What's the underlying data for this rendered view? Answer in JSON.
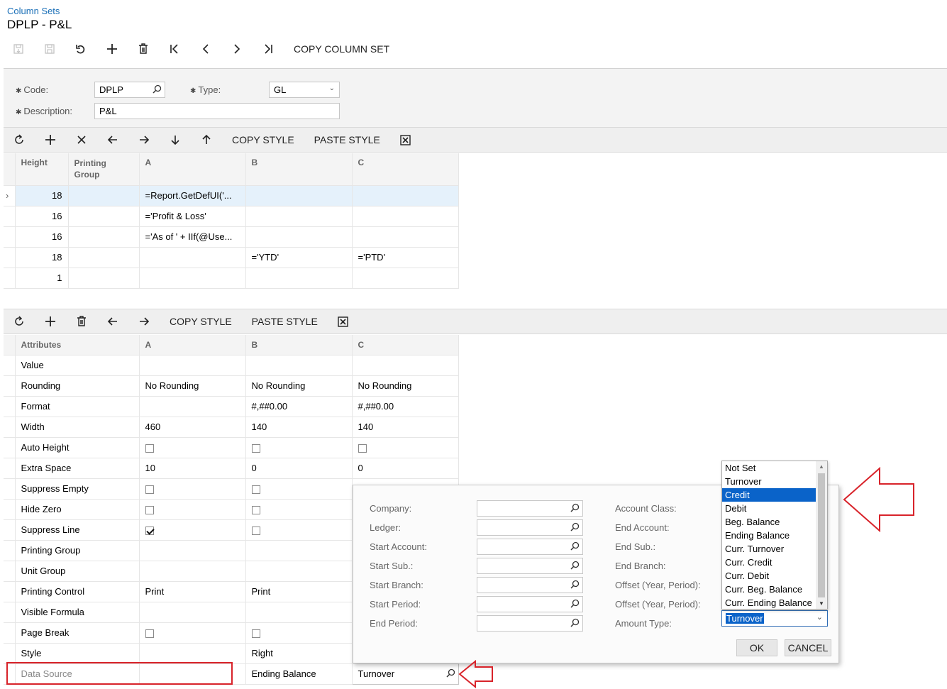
{
  "header": {
    "breadcrumb": "Column Sets",
    "title": "DPLP - P&L"
  },
  "main_toolbar": {
    "copy_column_set": "COPY COLUMN SET"
  },
  "form": {
    "code_label": "Code:",
    "code_value": "DPLP",
    "type_label": "Type:",
    "type_value": "GL",
    "description_label": "Description:",
    "description_value": "P&L"
  },
  "headers_toolbar": {
    "copy_style": "COPY STYLE",
    "paste_style": "PASTE STYLE"
  },
  "headers_grid": {
    "columns": [
      "Height",
      "Printing Group",
      "A",
      "B",
      "C"
    ],
    "rows": [
      {
        "height": "18",
        "group": "",
        "a": "=Report.GetDefUI('...",
        "b": "",
        "c": ""
      },
      {
        "height": "16",
        "group": "",
        "a": "='Profit & Loss'",
        "b": "",
        "c": ""
      },
      {
        "height": "16",
        "group": "",
        "a": "='As of ' + IIf(@Use...",
        "b": "",
        "c": ""
      },
      {
        "height": "18",
        "group": "",
        "a": "",
        "b": "='YTD'",
        "c": "='PTD'"
      },
      {
        "height": "1",
        "group": "",
        "a": "",
        "b": "",
        "c": ""
      }
    ]
  },
  "attributes_toolbar": {
    "copy_style": "COPY STYLE",
    "paste_style": "PASTE STYLE"
  },
  "attributes_grid": {
    "columns": [
      "Attributes",
      "A",
      "B",
      "C"
    ],
    "rows": [
      {
        "label": "Value",
        "a": "",
        "b": "",
        "c": ""
      },
      {
        "label": "Rounding",
        "a": "No Rounding",
        "b": "No Rounding",
        "c": "No Rounding"
      },
      {
        "label": "Format",
        "a": "",
        "b": "#,##0.00",
        "c": "#,##0.00"
      },
      {
        "label": "Width",
        "a": "460",
        "b": "140",
        "c": "140"
      },
      {
        "label": "Auto Height",
        "a_check": false,
        "b_check": false,
        "c_check": false
      },
      {
        "label": "Extra Space",
        "a": "10",
        "b": "0",
        "c": "0"
      },
      {
        "label": "Suppress Empty",
        "a_check": false,
        "b_check": false
      },
      {
        "label": "Hide Zero",
        "a_check": false,
        "b_check": false
      },
      {
        "label": "Suppress Line",
        "a_check": true,
        "b_check": false
      },
      {
        "label": "Printing Group",
        "a": "",
        "b": ""
      },
      {
        "label": "Unit Group",
        "a": "",
        "b": ""
      },
      {
        "label": "Printing Control",
        "a": "Print",
        "b": "Print"
      },
      {
        "label": "Visible Formula",
        "a": "",
        "b": ""
      },
      {
        "label": "Page Break",
        "a_check": false,
        "b_check": false
      },
      {
        "label": "Style",
        "a": "",
        "b": "Right"
      },
      {
        "label": "Data Source",
        "a": "",
        "b": "Ending Balance",
        "c": "Turnover"
      }
    ]
  },
  "data_source_popup": {
    "left_labels": [
      "Company:",
      "Ledger:",
      "Start Account:",
      "Start Sub.:",
      "Start Branch:",
      "Start Period:",
      "End Period:"
    ],
    "right_labels": [
      "Account Class:",
      "End Account:",
      "End Sub.:",
      "End Branch:",
      "Offset (Year, Period):",
      "Offset (Year, Period):",
      "Amount Type:"
    ],
    "amount_type_value": "Turnover",
    "ok": "OK",
    "cancel": "CANCEL"
  },
  "amount_type_dropdown": {
    "options": [
      "Not Set",
      "Turnover",
      "Credit",
      "Debit",
      "Beg. Balance",
      "Ending Balance",
      "Curr. Turnover",
      "Curr. Credit",
      "Curr. Debit",
      "Curr. Beg. Balance",
      "Curr. Ending Balance"
    ],
    "highlighted_index": 2
  },
  "colors": {
    "accent": "#1a6fb7",
    "highlight": "#0a63c9",
    "annotation": "#d8232a",
    "selected_row": "#e5f1fb"
  }
}
